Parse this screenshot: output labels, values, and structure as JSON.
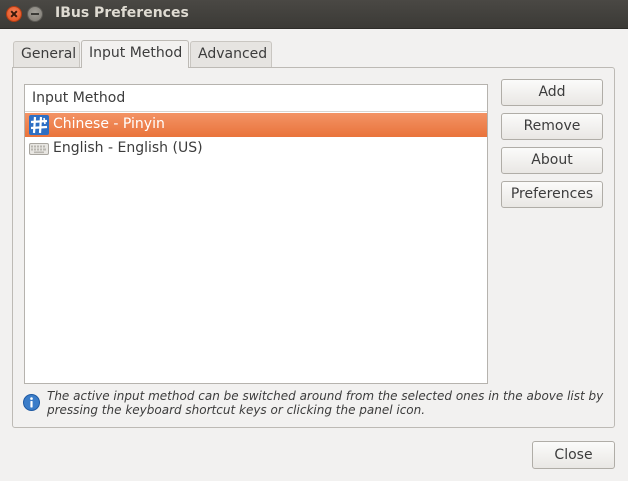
{
  "window": {
    "title": "IBus Preferences"
  },
  "tabs": [
    {
      "label": "General",
      "active": false
    },
    {
      "label": "Input Method",
      "active": true
    },
    {
      "label": "Advanced",
      "active": false
    }
  ],
  "list": {
    "header": "Input Method",
    "rows": [
      {
        "label": "Chinese - Pinyin",
        "icon": "pinyin-icon",
        "selected": true
      },
      {
        "label": "English - English (US)",
        "icon": "keyboard-icon",
        "selected": false
      }
    ]
  },
  "buttons": {
    "add": "Add",
    "remove": "Remove",
    "about": "About",
    "preferences": "Preferences",
    "close": "Close"
  },
  "info": {
    "icon": "info-icon",
    "text": "The active input method can be switched around from the selected ones in the above list by pressing the keyboard shortcut keys or clicking the panel icon."
  },
  "colors": {
    "selection": "#e9733b",
    "titlebar": "#3b3a36",
    "close_button": "#df4a16"
  }
}
